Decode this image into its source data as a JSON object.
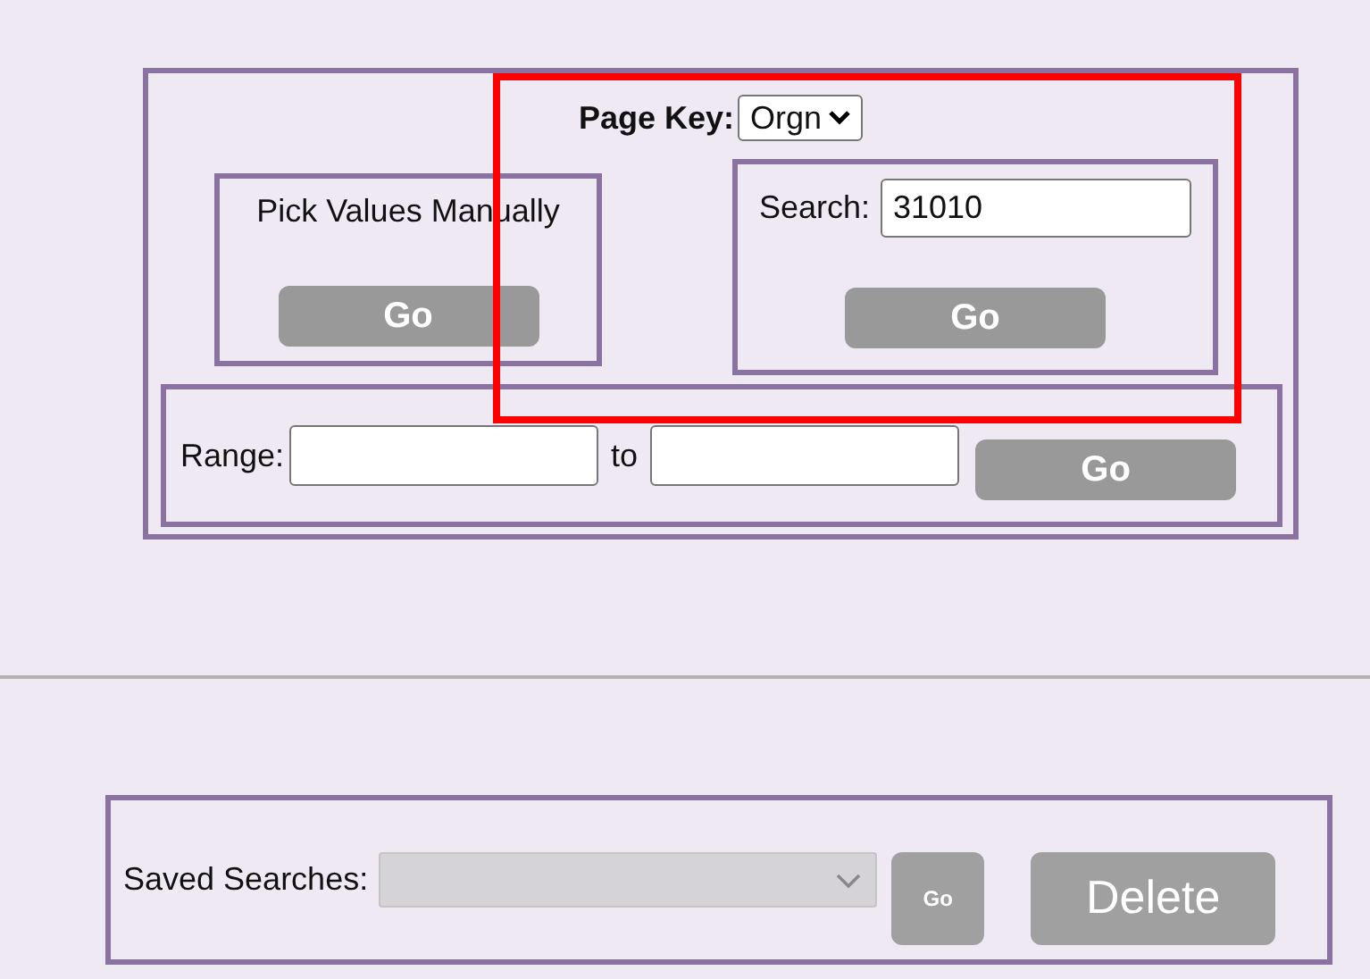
{
  "page_key": {
    "label": "Page Key:",
    "value": "Orgn"
  },
  "manual": {
    "label": "Pick Values Manually",
    "button": "Go"
  },
  "search": {
    "label": "Search:",
    "value": "31010",
    "button": "Go"
  },
  "range": {
    "label": "Range:",
    "separator": "to",
    "button": "Go"
  },
  "saved_searches": {
    "label": "Saved Searches:",
    "disabled": true,
    "load_button": "Go",
    "delete_button": "Delete"
  }
}
